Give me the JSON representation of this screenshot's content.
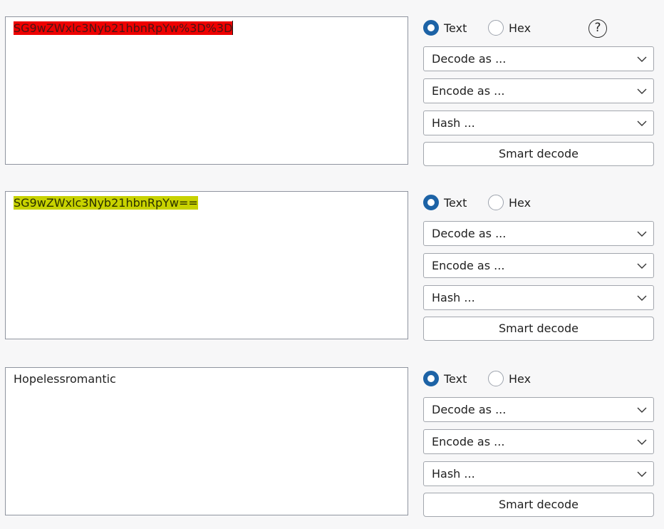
{
  "panels": [
    {
      "content": "SG9wZWxlc3Nyb21hbnRpYw%3D%3D",
      "highlight": "#ee0000",
      "text_label": "Text",
      "hex_label": "Hex",
      "selected_mode": "Text",
      "decode_label": "Decode as ...",
      "encode_label": "Encode as ...",
      "hash_label": "Hash ...",
      "smart_label": "Smart decode",
      "help_glyph": "?"
    },
    {
      "content": "SG9wZWxlc3Nyb21hbnRpYw==",
      "highlight": "#c8d200",
      "text_label": "Text",
      "hex_label": "Hex",
      "selected_mode": "Text",
      "decode_label": "Decode as ...",
      "encode_label": "Encode as ...",
      "hash_label": "Hash ...",
      "smart_label": "Smart decode"
    },
    {
      "content": "Hopelessromantic",
      "text_label": "Text",
      "hex_label": "Hex",
      "selected_mode": "Text",
      "decode_label": "Decode as ...",
      "encode_label": "Encode as ...",
      "hash_label": "Hash ...",
      "smart_label": "Smart decode"
    }
  ],
  "icons": {
    "dropdown": "chevron-down-icon",
    "help": "help-icon"
  },
  "colors": {
    "radio_selected": "#1d63a6",
    "panel_border": "#8f949f"
  }
}
